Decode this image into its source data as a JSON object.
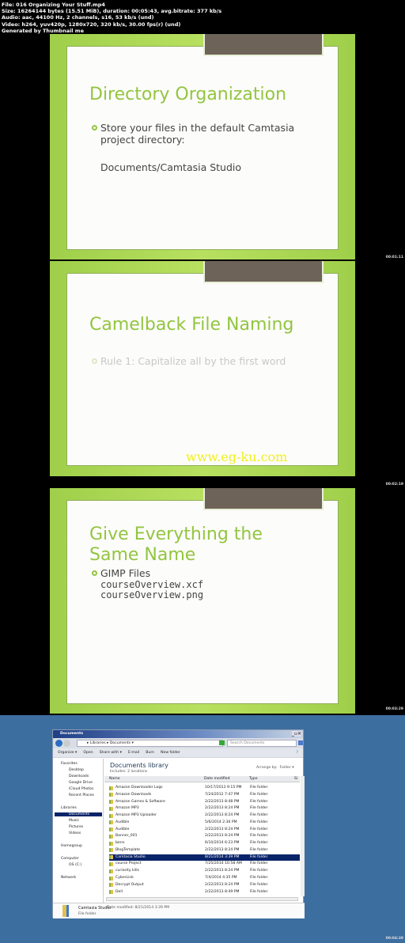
{
  "header": {
    "lines": [
      "File: 016 Organizing Your Stuff.mp4",
      "Size: 16264144 bytes (15.51 MiB), duration: 00:05:43, avg.bitrate: 377 kb/s",
      "Audio: aac, 44100 Hz, 2 channels, s16, 53 kb/s (und)",
      "Video: h264, yuv420p, 1280x720, 320 kb/s, 30.00 fps(r) (und)",
      "Generated by Thumbnail me"
    ]
  },
  "frames": [
    {
      "timestamp": "00:01:11",
      "title": "Directory Organization",
      "bullet": "Store your files in the default Camtasia project directory:",
      "sub": "Documents/Camtasia Studio"
    },
    {
      "timestamp": "00:02:19",
      "title": "Camelback File Naming",
      "bullet": "Rule 1: Capitalize all by the first word",
      "watermark": "www.eg-ku.com"
    },
    {
      "timestamp": "00:03:29",
      "title": "Give Everything the Same Name",
      "bullet": "GIMP Files",
      "code": [
        "courseOverview.xcf",
        "courseOverview.png"
      ]
    },
    {
      "timestamp": "00:04:38"
    }
  ],
  "explorer": {
    "title": "Documents",
    "breadcrumb": [
      "Libraries",
      "Documents"
    ],
    "search_placeholder": "Search Documents",
    "toolbar": [
      "Organize ▾",
      "Open",
      "Share with ▾",
      "E-mail",
      "Burn",
      "New folder"
    ],
    "library_title": "Documents library",
    "includes": "Includes: 2 locations",
    "arrange_label": "Arrange by:",
    "arrange_value": "Folder ▾",
    "columns": [
      "Name",
      "Date modified",
      "Type",
      "Si"
    ],
    "nav": [
      "Favorites",
      "Desktop",
      "Downloads",
      "Google Drive",
      "iCloud Photos",
      "Recent Places",
      "Libraries",
      "Documents",
      "Music",
      "Pictures",
      "Videos",
      "Homegroup",
      "Computer",
      "OS (C:)",
      "Network"
    ],
    "rows": [
      [
        "Amazon Downloader Logs",
        "10/17/2013 9:15 PM",
        "File folder"
      ],
      [
        "Amazon Downloads",
        "7/24/2012 7:47 PM",
        "File folder"
      ],
      [
        "Amazon Games & Software",
        "2/22/2013 8:48 PM",
        "File folder"
      ],
      [
        "Amazon MP3",
        "2/22/2013 8:24 PM",
        "File folder"
      ],
      [
        "Amazon MP3 Uploader",
        "2/22/2013 8:24 PM",
        "File folder"
      ],
      [
        "Audible",
        "5/6/2014 2:36 PM",
        "File folder"
      ],
      [
        "Audible",
        "2/22/2013 8:24 PM",
        "File folder"
      ],
      [
        "Banner_001",
        "2/22/2013 8:24 PM",
        "File folder"
      ],
      [
        "benn",
        "6/10/2014 6:23 PM",
        "File folder"
      ],
      [
        "BlogTemplate",
        "2/22/2013 8:24 PM",
        "File folder"
      ],
      [
        "Camtasia Studio",
        "8/21/2014 3:39 PM",
        "File folder"
      ],
      [
        "course Project",
        "7/25/2014 10:58 AM",
        "File folder"
      ],
      [
        "curiosity kills",
        "2/22/2013 8:24 PM",
        "File folder"
      ],
      [
        "CyberLink",
        "7/4/2014 4:35 PM",
        "File folder"
      ],
      [
        "Decrypt Output",
        "2/22/2013 8:24 PM",
        "File folder"
      ],
      [
        "Dell",
        "2/22/2013 8:49 PM",
        "File folder"
      ]
    ],
    "selected_row": 10,
    "details": {
      "name": "Camtasia Studio",
      "modified": "Date modified: 8/21/2014 3:39 PM",
      "type": "File folder"
    }
  }
}
